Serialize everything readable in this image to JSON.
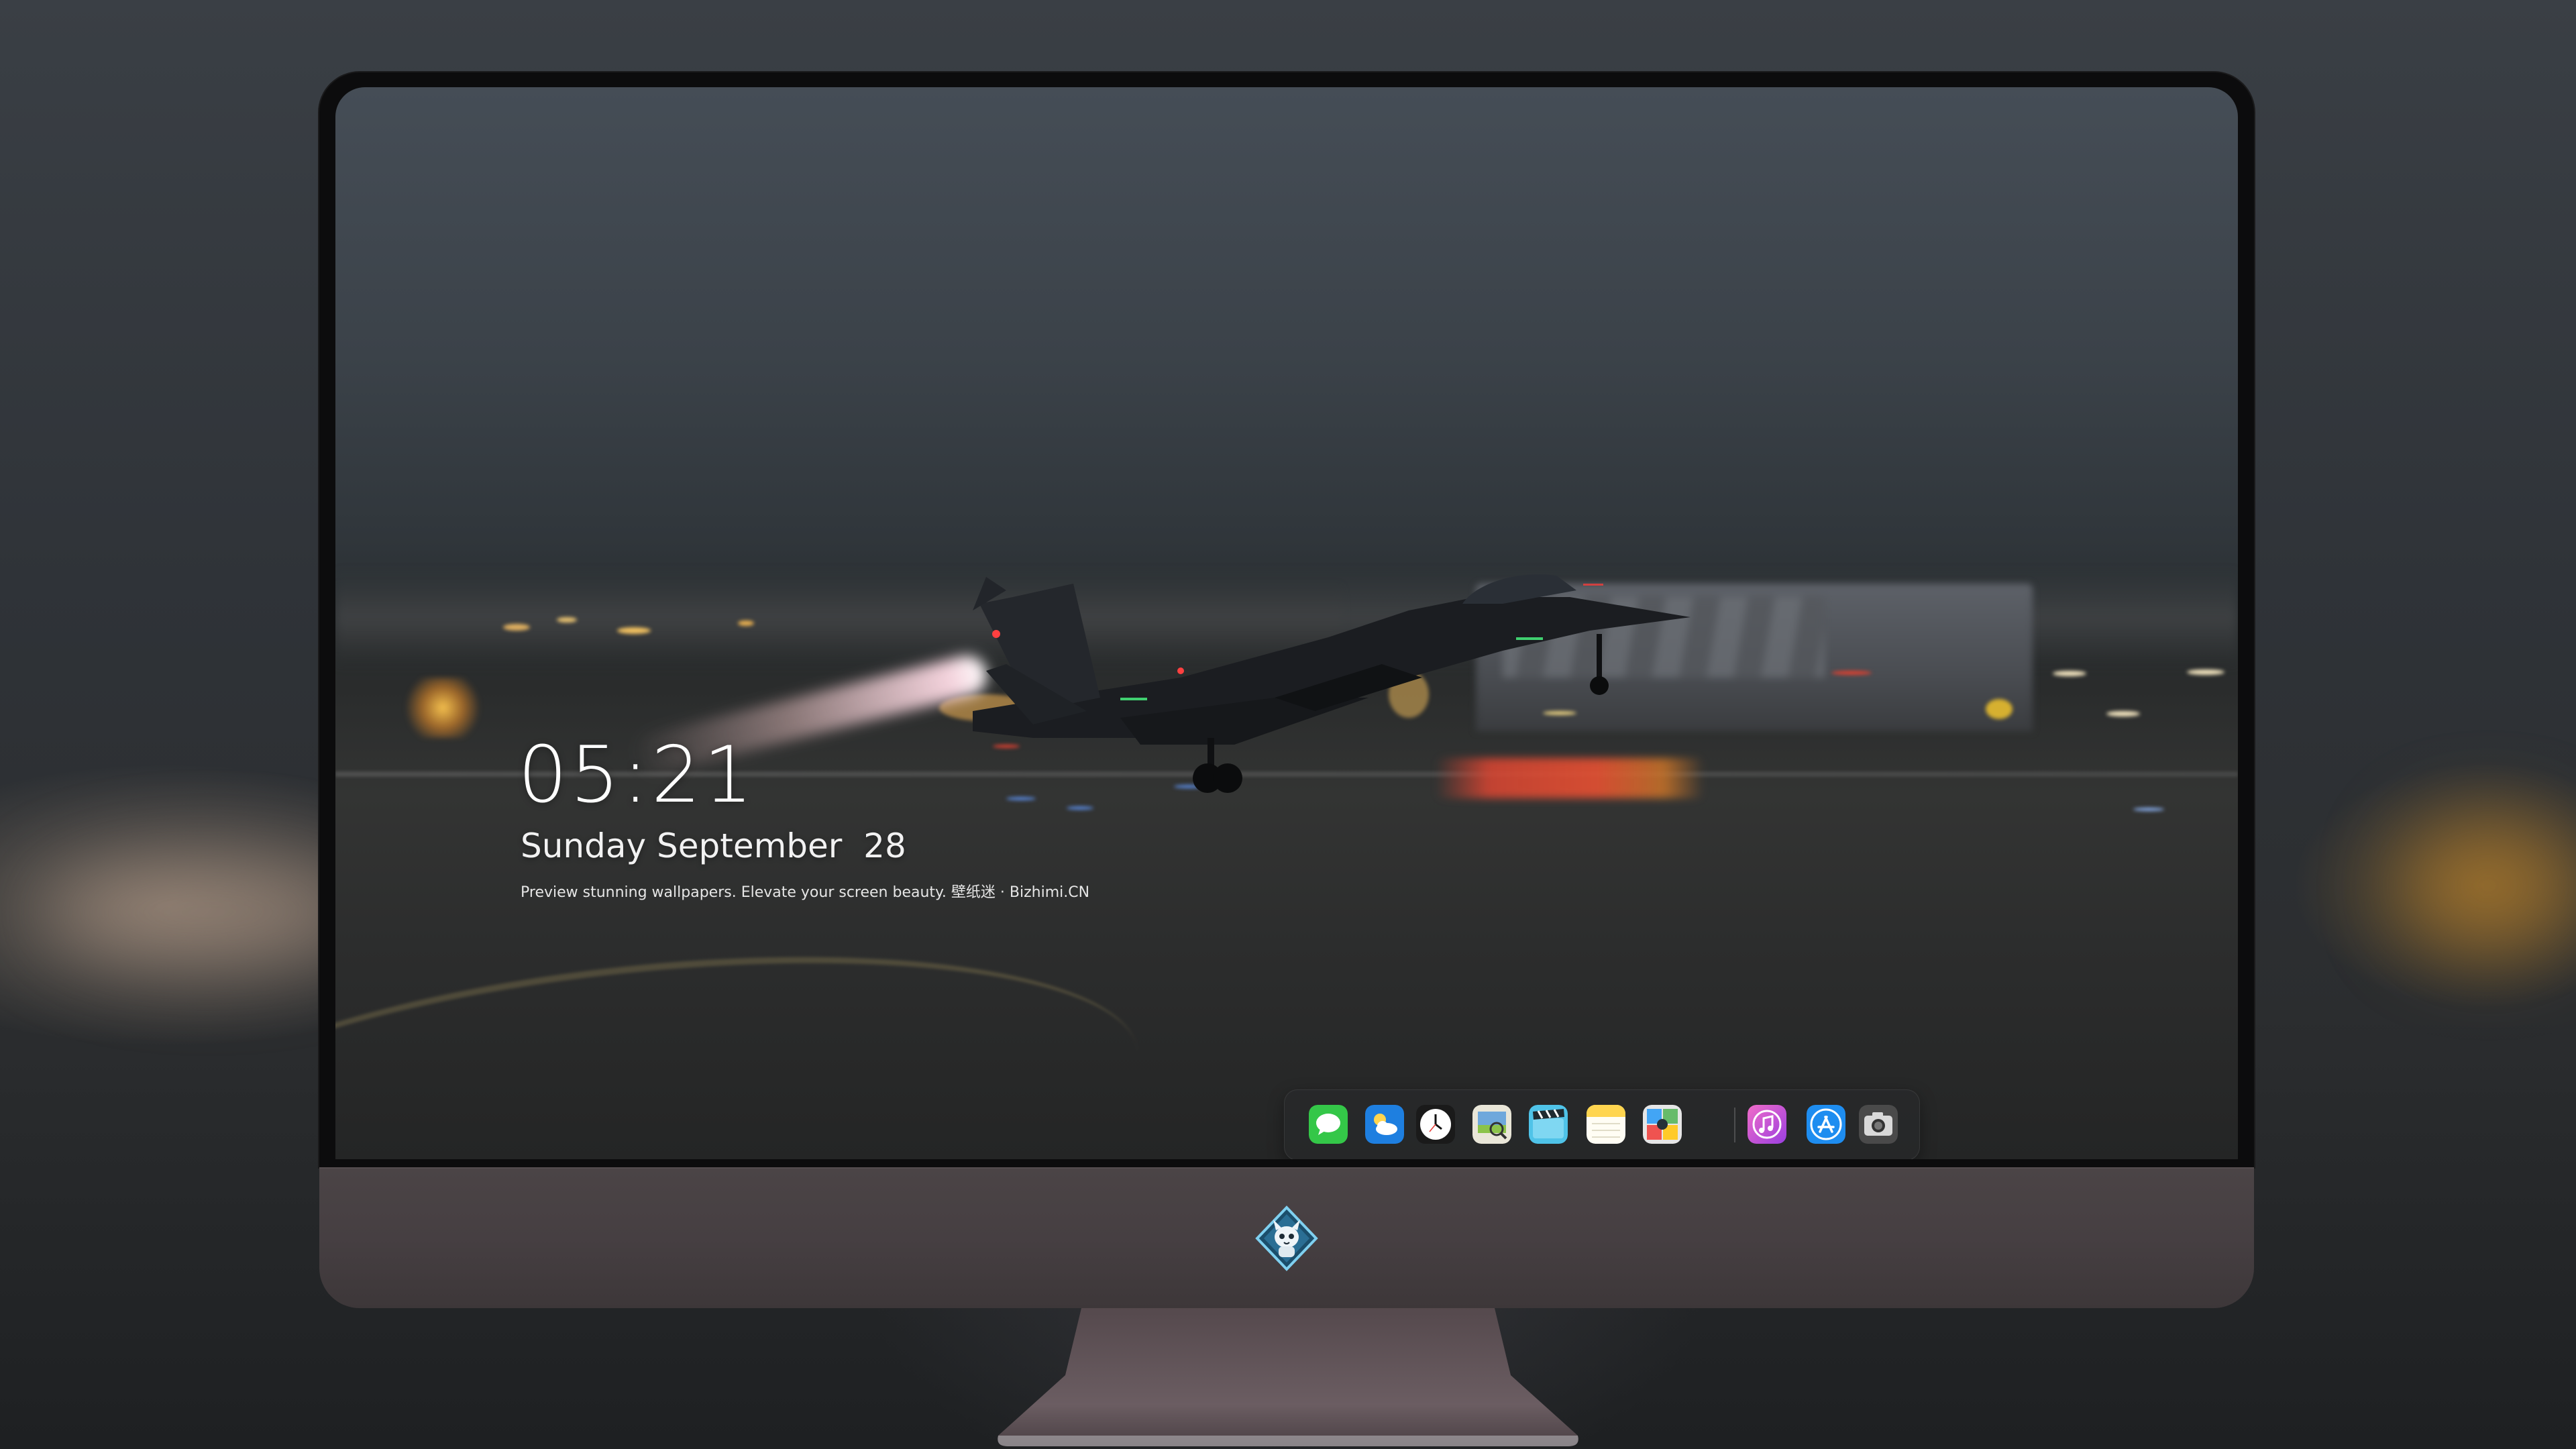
{
  "lockscreen": {
    "time": "05:21",
    "date": "Sunday September  28",
    "tagline": "Preview stunning wallpapers. Elevate your screen beauty. 壁纸迷 · Bizhimi.CN"
  },
  "dock": {
    "items": [
      {
        "name": "Messages",
        "icon": "messages-icon",
        "color": "#2ecc40"
      },
      {
        "name": "Weather",
        "icon": "weather-icon",
        "color": "#1e88e5"
      },
      {
        "name": "Clock",
        "icon": "clock-icon",
        "color": "#ffffff"
      },
      {
        "name": "Preview",
        "icon": "preview-icon",
        "color": "#f5f5f0"
      },
      {
        "name": "Clips",
        "icon": "clips-icon",
        "color": "#4fc3e8"
      },
      {
        "name": "Notes",
        "icon": "notes-icon",
        "color": "#ffd54f"
      },
      {
        "name": "Photo Booth",
        "icon": "photo-booth-icon",
        "color": "#e0e0e0"
      },
      {
        "name": "iTunes",
        "icon": "itunes-icon",
        "color": "#d84fd8"
      },
      {
        "name": "App Store",
        "icon": "app-store-icon",
        "color": "#1e8df0"
      },
      {
        "name": "Screenshot",
        "icon": "camera-icon",
        "color": "#555555"
      }
    ]
  },
  "monitor": {
    "logo": "mascot-logo-icon"
  }
}
